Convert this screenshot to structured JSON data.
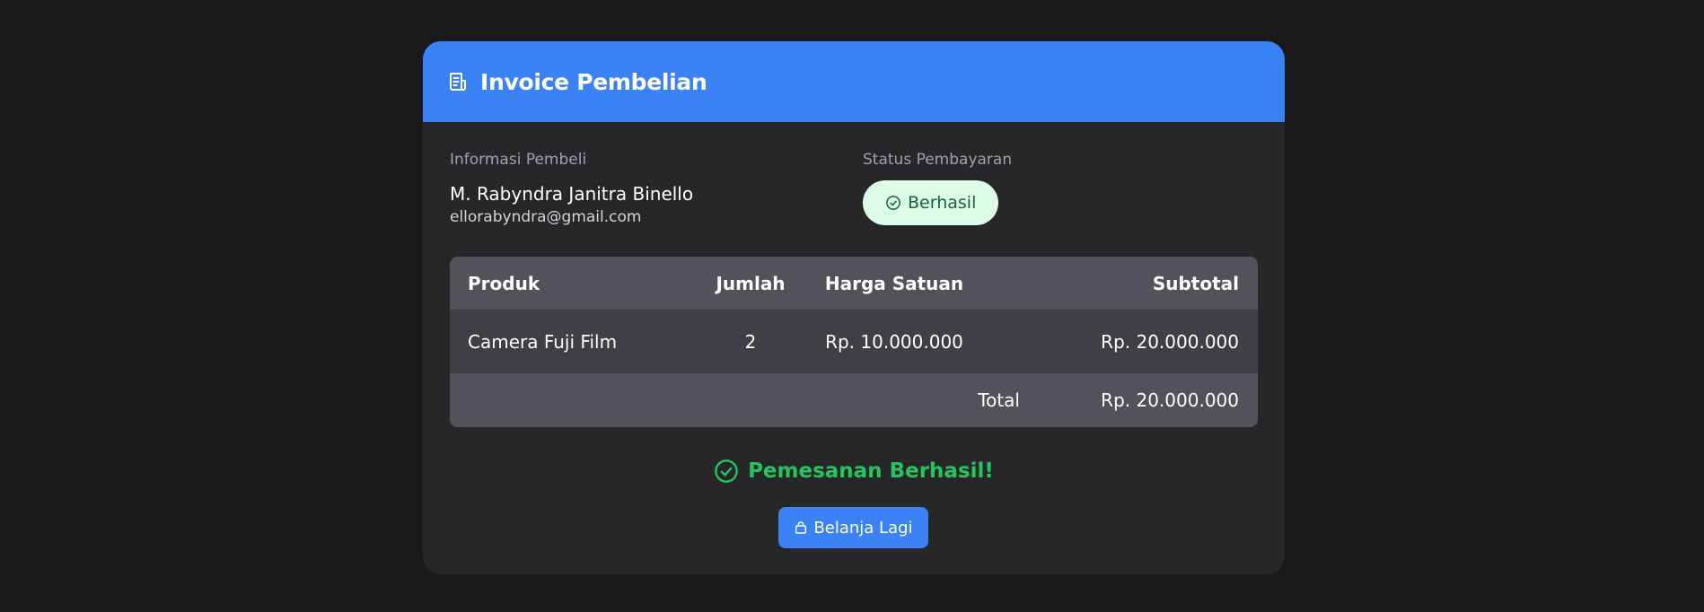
{
  "header": {
    "icon": "receipt-icon",
    "title": "Invoice Pembelian"
  },
  "buyer": {
    "label": "Informasi Pembeli",
    "name": "M. Rabyndra Janitra Binello",
    "email": "ellorabyndra@gmail.com"
  },
  "payment": {
    "label": "Status Pembayaran",
    "status": "Berhasil",
    "icon": "check-circle-icon"
  },
  "table": {
    "headers": [
      "Produk",
      "Jumlah",
      "Harga Satuan",
      "Subtotal"
    ],
    "rows": [
      {
        "product": "Camera Fuji Film",
        "qty": "2",
        "price": "Rp. 10.000.000",
        "subtotal": "Rp. 20.000.000"
      }
    ],
    "total_label": "Total",
    "total_value": "Rp. 20.000.000"
  },
  "success": {
    "icon": "check-circle-icon",
    "message": "Pemesanan Berhasil!"
  },
  "button": {
    "icon": "shopping-bag-icon",
    "label": "Belanja Lagi"
  },
  "colors": {
    "background": "#19191b",
    "card": "#27272a",
    "accent": "#3b82f6",
    "success": "#22c55e",
    "badge_bg": "#dcfce7",
    "badge_text": "#166534"
  }
}
